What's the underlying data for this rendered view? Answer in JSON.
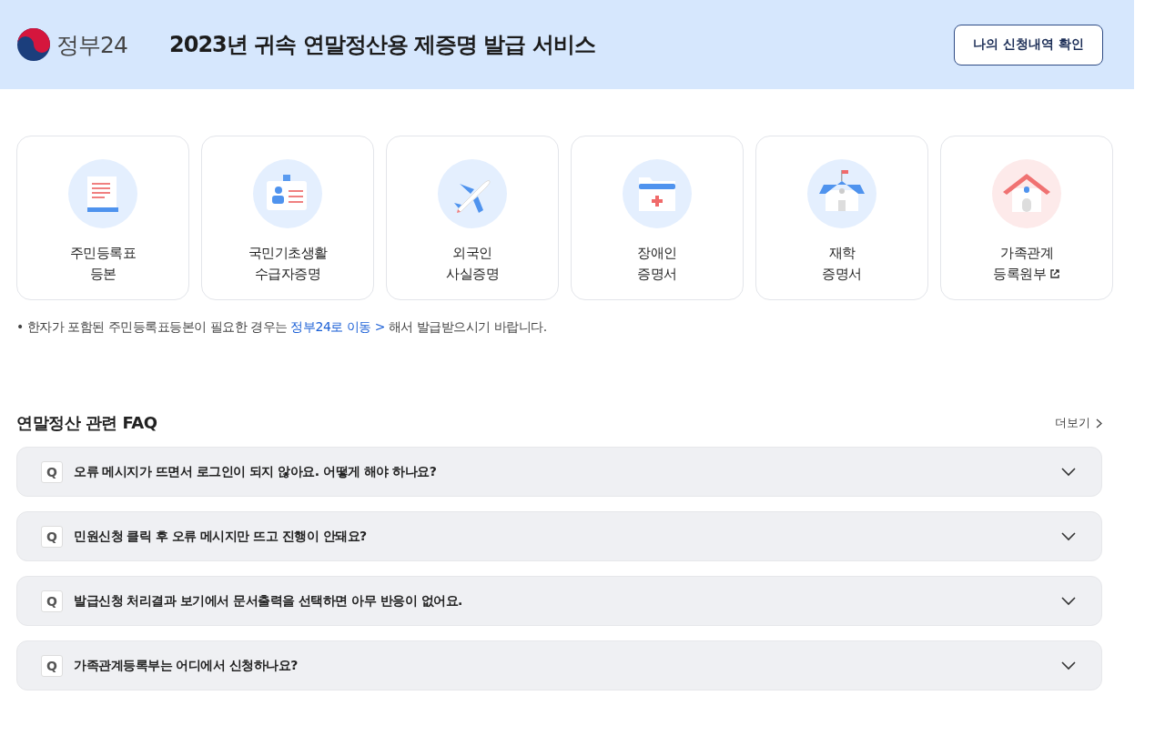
{
  "header": {
    "logo_text": "정부24",
    "title": "2023년 귀속 연말정산용 제증명 발급 서비스",
    "button": "나의 신청내역 확인"
  },
  "services": [
    {
      "lines": [
        "주민등록표",
        "등본"
      ],
      "external": false
    },
    {
      "lines": [
        "국민기초생활",
        "수급자증명"
      ],
      "external": false
    },
    {
      "lines": [
        "외국인",
        "사실증명"
      ],
      "external": false
    },
    {
      "lines": [
        "장애인",
        "증명서"
      ],
      "external": false
    },
    {
      "lines": [
        "재학",
        "증명서"
      ],
      "external": false
    },
    {
      "lines": [
        "가족관계",
        "등록원부"
      ],
      "external": true
    }
  ],
  "notice": {
    "bullet": "•",
    "before": "한자가 포함된 주민등록표등본이 필요한 경우는",
    "link": "정부24로 이동 >",
    "after": "해서 발급받으시기 바랍니다."
  },
  "faq": {
    "title": "연말정산 관련 FAQ",
    "more": "더보기",
    "items": [
      {
        "mark": "Q",
        "question": "오류 메시지가 뜨면서 로그인이 되지 않아요. 어떻게 해야 하나요?",
        "expanded": false
      },
      {
        "mark": "Q",
        "question": "민원신청 클릭 후 오류 메시지만 뜨고 진행이 안돼요?",
        "expanded": false
      },
      {
        "mark": "Q",
        "question": "발급신청 처리결과 보기에서 문서출력을 선택하면 아무 반응이 없어요.",
        "expanded": false
      },
      {
        "mark": "Q",
        "question": "가족관계등록부는 어디에서 신청하나요?",
        "expanded": false
      }
    ]
  }
}
